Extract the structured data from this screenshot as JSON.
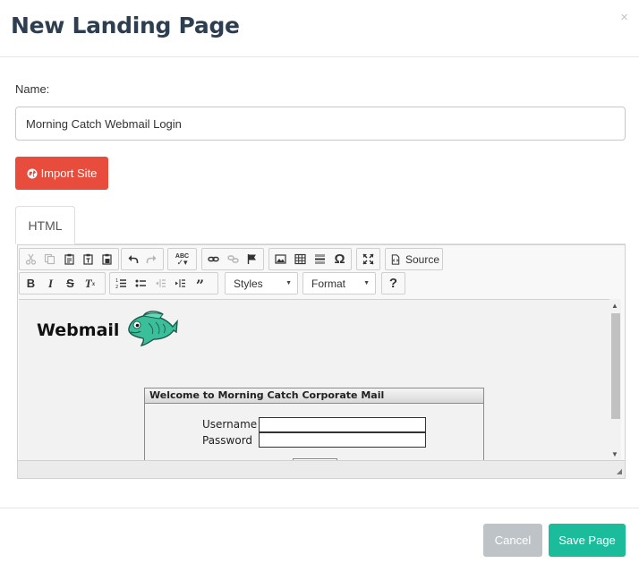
{
  "modal": {
    "title": "New Landing Page",
    "close_label": "×"
  },
  "form": {
    "name_label": "Name:",
    "name_value": "Morning Catch Webmail Login",
    "import_label": "Import Site"
  },
  "tabs": [
    {
      "label": "HTML",
      "active": true
    }
  ],
  "editor": {
    "toolbar_row1": [
      {
        "icon": "cut-icon",
        "enabled": false
      },
      {
        "icon": "copy-icon",
        "enabled": false
      },
      {
        "icon": "paste-icon",
        "enabled": true
      },
      {
        "icon": "paste-text-icon",
        "enabled": true
      },
      {
        "icon": "paste-word-icon",
        "enabled": true
      },
      {
        "icon": "undo-icon",
        "enabled": true
      },
      {
        "icon": "redo-icon",
        "enabled": false
      },
      {
        "icon": "spellcheck-icon",
        "enabled": true
      },
      {
        "icon": "link-icon",
        "enabled": true
      },
      {
        "icon": "unlink-icon",
        "enabled": false
      },
      {
        "icon": "anchor-icon",
        "enabled": true
      },
      {
        "icon": "image-icon",
        "enabled": true
      },
      {
        "icon": "table-icon",
        "enabled": true
      },
      {
        "icon": "horizontal-rule-icon",
        "enabled": true
      },
      {
        "icon": "special-char-icon",
        "enabled": true
      },
      {
        "icon": "maximize-icon",
        "enabled": true
      }
    ],
    "source_label": "Source",
    "styles_label": "Styles",
    "format_label": "Format",
    "help_label": "?",
    "omega_glyph": "Ω",
    "spell_glyph": "ABC"
  },
  "preview": {
    "logo_text": "Webmail",
    "login_header": "Welcome to Morning Catch Corporate Mail",
    "username_label": "Username",
    "password_label": "Password"
  },
  "footer": {
    "cancel_label": "Cancel",
    "save_label": "Save Page"
  },
  "colors": {
    "title": "#2c3e50",
    "import_button": "#e74c3c",
    "save_button": "#1abc9c",
    "cancel_button": "#bdc3c7"
  }
}
